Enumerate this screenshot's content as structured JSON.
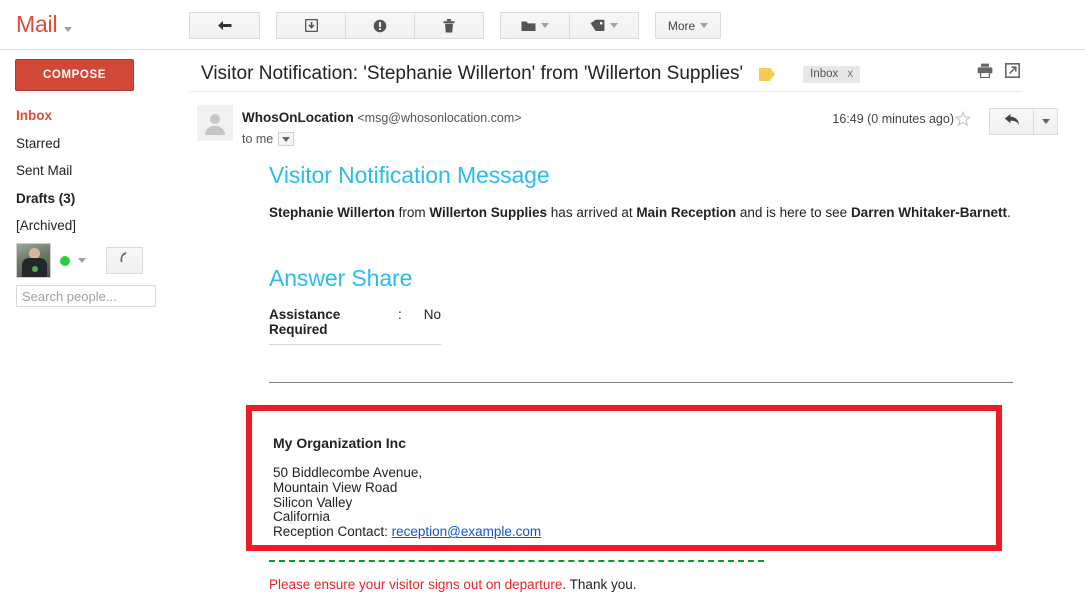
{
  "topbar": {
    "brand": "Mail",
    "brand_caret": "chevron-down-icon",
    "toolbar": {
      "back_icon": "back-arrow-icon",
      "archive_icon": "archive-icon",
      "spam_icon": "report-spam-icon",
      "delete_icon": "trash-icon",
      "move_icon": "folder-icon",
      "labels_icon": "label-tag-icon",
      "more_label": "More"
    }
  },
  "sidebar": {
    "compose_label": "COMPOSE",
    "items": [
      {
        "label": "Inbox",
        "state": "active"
      },
      {
        "label": "Starred",
        "state": "normal"
      },
      {
        "label": "Sent Mail",
        "state": "normal"
      },
      {
        "label": "Drafts (3)",
        "state": "bold"
      },
      {
        "label": "[Archived]",
        "state": "normal"
      }
    ],
    "chat": {
      "status": "available",
      "status_color": "#2ecc40",
      "phone_icon": "phone-icon",
      "search_placeholder": "Search people..."
    }
  },
  "message": {
    "subject": "Visitor Notification: 'Stephanie Willerton' from 'Willerton Supplies'",
    "label_flag_icon": "label-flag-icon",
    "label_flag_color": "#f7cb4d",
    "chip_label": "Inbox",
    "chip_remove": "x",
    "print_icon": "print-icon",
    "popout_icon": "open-in-new-window-icon",
    "sender_name": "WhosOnLocation",
    "sender_email": "<msg@whosonlocation.com>",
    "recipient": "to me",
    "timestamp": "16:49 (0 minutes ago)",
    "star_icon": "star-outline-icon",
    "reply_icon": "reply-icon",
    "reply_more_icon": "chevron-down-icon"
  },
  "body": {
    "heading_1": "Visitor Notification Message",
    "intro": {
      "visitor": "Stephanie Willerton",
      "from_word": " from ",
      "company": "Willerton Supplies",
      "arrived_text": " has arrived at ",
      "location": "Main Reception",
      "here_to_see_text": " and is here to see ",
      "host": "Darren Whitaker-Barnett",
      "end": "."
    },
    "heading_2": "Answer Share",
    "field": {
      "label": "Assistance Required",
      "colon": ":",
      "value": "No"
    },
    "organization": {
      "name": "My Organization Inc",
      "address_lines": [
        "50 Biddlecombe Avenue,",
        "Mountain View Road",
        "Silicon Valley",
        "California"
      ],
      "contact_label": "Reception Contact: ",
      "contact_email": "reception@example.com",
      "border_color": "#ed1c24"
    },
    "footer": {
      "red_text": "Please ensure your visitor signs out on departure",
      "black_text": ". Thank you.",
      "divider_color": "#0a9b2e"
    },
    "heading_color": "#29bdef"
  }
}
